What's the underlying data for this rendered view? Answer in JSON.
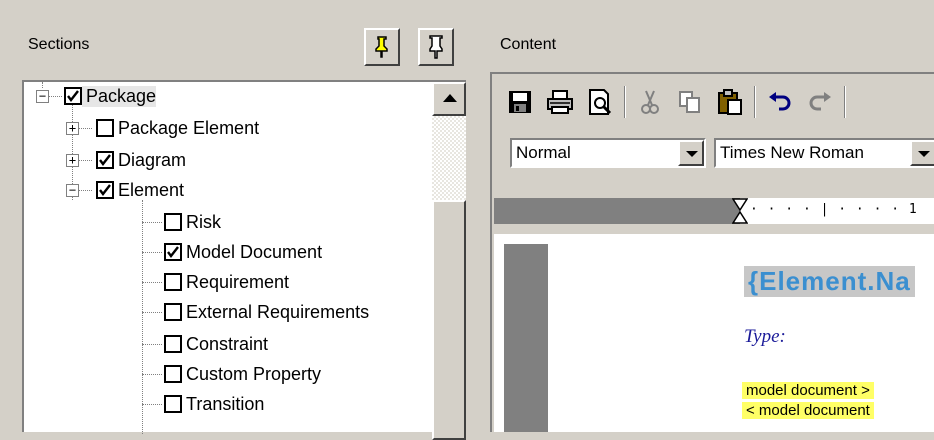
{
  "sections": {
    "title": "Sections",
    "tree": [
      {
        "label": "Package",
        "checked": true,
        "expander": "−"
      },
      {
        "label": "Package Element",
        "checked": false,
        "expander": "+"
      },
      {
        "label": "Diagram",
        "checked": true,
        "expander": "+"
      },
      {
        "label": "Element",
        "checked": true,
        "expander": "−"
      },
      {
        "label": "Risk",
        "checked": false
      },
      {
        "label": "Model Document",
        "checked": true
      },
      {
        "label": "Requirement",
        "checked": false
      },
      {
        "label": "External Requirements",
        "checked": false
      },
      {
        "label": "Constraint",
        "checked": false
      },
      {
        "label": "Custom Property",
        "checked": false
      },
      {
        "label": "Transition",
        "checked": false
      }
    ]
  },
  "content": {
    "title": "Content",
    "style_value": "Normal",
    "font_value": "Times New Roman",
    "ruler_number": "1",
    "doc": {
      "heading": "{Element.Na",
      "type_label": "Type:",
      "line1": "model document >",
      "line2": "< model document"
    }
  }
}
